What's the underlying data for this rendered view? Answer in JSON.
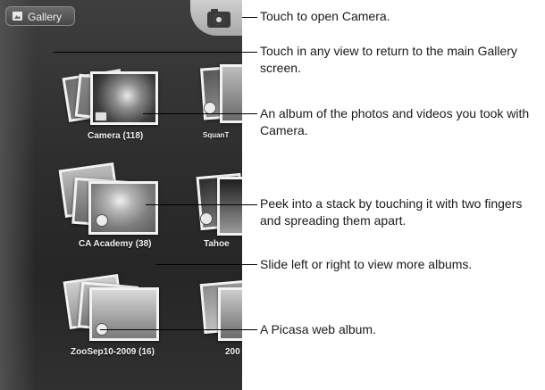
{
  "header": {
    "gallery_button_label": "Gallery",
    "camera_button_icon": "camera-icon"
  },
  "albums": [
    {
      "label": "Camera  (118)"
    },
    {
      "label": "SquanT"
    },
    {
      "label": "CA Academy  (38)"
    },
    {
      "label": "Tahoe"
    },
    {
      "label": "ZooSep10-2009  (16)"
    },
    {
      "label": "200"
    }
  ],
  "callouts": [
    {
      "text": "Touch to open Camera."
    },
    {
      "text": "Touch in any view to return to the main Gallery screen."
    },
    {
      "text": "An album of the photos and videos you took with Camera."
    },
    {
      "text": "Peek into a stack by touching it with two fingers and spreading them apart."
    },
    {
      "text": "Slide left or right to view more albums."
    },
    {
      "text": "A Picasa web album."
    }
  ]
}
